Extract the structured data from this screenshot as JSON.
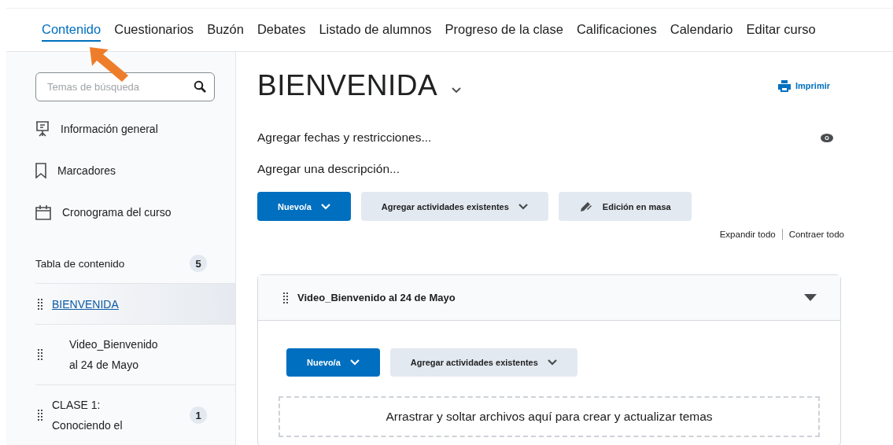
{
  "nav": [
    {
      "label": "Contenido",
      "selected": true
    },
    {
      "label": "Cuestionarios",
      "selected": false
    },
    {
      "label": "Buzón",
      "selected": false
    },
    {
      "label": "Debates",
      "selected": false
    },
    {
      "label": "Listado de alumnos",
      "selected": false
    },
    {
      "label": "Progreso de la clase",
      "selected": false
    },
    {
      "label": "Calificaciones",
      "selected": false
    },
    {
      "label": "Calendario",
      "selected": false
    },
    {
      "label": "Editar curso",
      "selected": false
    }
  ],
  "sidebar": {
    "search": {
      "placeholder": "Temas de búsqueda"
    },
    "links": [
      {
        "kind": "overview",
        "label": "Información general"
      },
      {
        "kind": "bookmarks",
        "label": "Marcadores"
      },
      {
        "kind": "schedule",
        "label": "Cronograma del curso"
      }
    ],
    "toc": {
      "label": "Tabla de contenido",
      "count": "5",
      "items": [
        {
          "label": "BIENVENIDA",
          "selected": true,
          "indented": false
        },
        {
          "label": "Video_Bienvenido al 24 de Mayo",
          "selected": false,
          "indented": true
        },
        {
          "label": "CLASE 1: Conociendo el",
          "selected": false,
          "indented": false,
          "count": "1"
        }
      ]
    }
  },
  "main": {
    "title": "BIENVENIDA",
    "print": "Imprimir",
    "dates": "Agregar fechas y restricciones...",
    "description": "Agregar una descripción...",
    "buttons": [
      {
        "kind": "primary",
        "label": "Nuevo/a"
      },
      {
        "kind": "dropdown",
        "label": "Agregar actividades existentes"
      },
      {
        "kind": "bulk",
        "label": "Edición en masa"
      }
    ],
    "expand": "Expandir todo",
    "collapse": "Contraer todo",
    "module": {
      "title": "Video_Bienvenido al 24 de Mayo",
      "expanded": true,
      "buttons": [
        {
          "kind": "primary",
          "label": "Nuevo/a"
        },
        {
          "kind": "dropdown",
          "label": "Agregar actividades existentes"
        }
      ],
      "dropzone": "Arrastrar y soltar archivos aquí para crear y actualizar temas"
    }
  }
}
